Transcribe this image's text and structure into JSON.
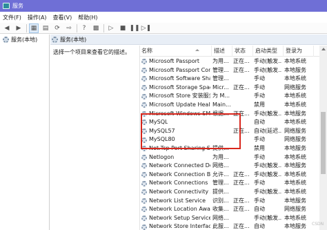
{
  "window": {
    "title": "服务"
  },
  "menu": [
    "文件(F)",
    "操作(A)",
    "查看(V)",
    "帮助(H)"
  ],
  "toolbar": {
    "icons": [
      "back-icon",
      "forward-icon",
      "console-tree-icon",
      "properties-icon",
      "refresh-icon",
      "export-icon",
      "help-icon",
      "start-icon",
      "stop-icon",
      "pause-icon",
      "restart-icon"
    ]
  },
  "tree": {
    "node_label": "服务(本地)"
  },
  "main": {
    "tab_label": "服务(本地)",
    "description_prompt": "选择一个项目来查看它的描述。"
  },
  "columns": [
    "名称",
    "描述",
    "状态",
    "启动类型",
    "登录为"
  ],
  "rows": [
    {
      "name": "Microsoft Passport",
      "desc": "为用...",
      "state": "",
      "start": "手动(触发...",
      "logon": "本地系统"
    },
    {
      "name": "Microsoft Passport Container",
      "desc": "管理...",
      "state": "",
      "start": "手动(触发...",
      "logon": "本地服务"
    },
    {
      "name": "Microsoft Software Shado...",
      "desc": "管理...",
      "state": "",
      "start": "手动",
      "logon": "本地系统"
    },
    {
      "name": "Microsoft Storage Spaces S...",
      "desc": "Micr...",
      "state": "",
      "start": "手动",
      "logon": "网络服务"
    },
    {
      "name": "Microsoft Store 安装服务",
      "desc": "为 M...",
      "state": "",
      "start": "手动",
      "logon": "本地系统"
    },
    {
      "name": "Microsoft Update Health S...",
      "desc": "Main...",
      "state": "",
      "start": "禁用",
      "logon": "本地系统"
    },
    {
      "name": "Microsoft Windows SMS 路...",
      "desc": "根据...",
      "state": "",
      "start": "手动(触发...",
      "logon": "本地服务"
    },
    {
      "name": "MySQL",
      "desc": "",
      "state": "",
      "start": "自动",
      "logon": "本地系统"
    },
    {
      "name": "MySQL57",
      "desc": "",
      "state": "",
      "start": "自动(延迟...",
      "logon": "网络服务"
    },
    {
      "name": "MySQL80",
      "desc": "",
      "state": "",
      "start": "手动",
      "logon": "网络服务"
    },
    {
      "name": "Net.Tcp Port Sharing Service",
      "desc": "提供...",
      "state": "",
      "start": "禁用",
      "logon": "本地服务"
    },
    {
      "name": "Netlogon",
      "desc": "为用...",
      "state": "",
      "start": "手动",
      "logon": "本地系统"
    },
    {
      "name": "Network Connected Devic...",
      "desc": "网络...",
      "state": "",
      "start": "手动(触发...",
      "logon": "本地服务"
    },
    {
      "name": "Network Connection Broker",
      "desc": "允许...",
      "state": "",
      "start": "手动(触发...",
      "logon": "本地系统"
    },
    {
      "name": "Network Connections",
      "desc": "管理...",
      "state": "",
      "start": "手动",
      "logon": "本地系统"
    },
    {
      "name": "Network Connectivity Assis...",
      "desc": "提供...",
      "state": "",
      "start": "手动(触发...",
      "logon": "本地系统"
    },
    {
      "name": "Network List Service",
      "desc": "识别...",
      "state": "",
      "start": "手动",
      "logon": "本地服务"
    },
    {
      "name": "Network Location Awarene...",
      "desc": "收集...",
      "state": "",
      "start": "自动",
      "logon": "网络服务"
    },
    {
      "name": "Network Setup Service",
      "desc": "网络...",
      "state": "",
      "start": "手动(触发...",
      "logon": "本地系统"
    },
    {
      "name": "Network Store Interface Se...",
      "desc": "此服...",
      "state": "",
      "start": "自动",
      "logon": "本地服务"
    }
  ],
  "state_running": "正在...",
  "running_rows": [
    0,
    1,
    3,
    6,
    8,
    13,
    14,
    16,
    17,
    19
  ],
  "highlight": {
    "color": "#d9261c"
  },
  "watermark": "CSDN"
}
